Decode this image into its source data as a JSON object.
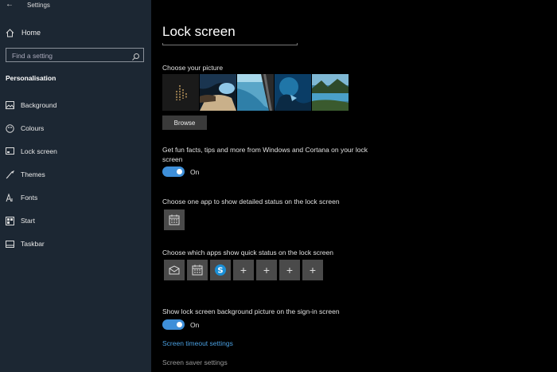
{
  "app": {
    "title": "Settings"
  },
  "sidebar": {
    "home_label": "Home",
    "search_placeholder": "Find a setting",
    "section": "Personalisation",
    "items": [
      {
        "label": "Background",
        "icon": "picture-icon"
      },
      {
        "label": "Colours",
        "icon": "palette-icon"
      },
      {
        "label": "Lock screen",
        "icon": "lock-screen-icon"
      },
      {
        "label": "Themes",
        "icon": "brush-icon"
      },
      {
        "label": "Fonts",
        "icon": "font-icon"
      },
      {
        "label": "Start",
        "icon": "start-icon"
      },
      {
        "label": "Taskbar",
        "icon": "taskbar-icon"
      }
    ]
  },
  "main": {
    "title": "Lock screen",
    "choose_picture_label": "Choose your picture",
    "browse_label": "Browse",
    "fun_facts_label": "Get fun facts, tips and more from Windows and Cortana on your lock screen",
    "fun_facts_state": "On",
    "detailed_status_label": "Choose one app to show detailed status on the lock screen",
    "quick_status_label": "Choose which apps show quick status on the lock screen",
    "signin_bg_label": "Show lock screen background picture on the sign-in screen",
    "signin_bg_state": "On",
    "timeout_link": "Screen timeout settings",
    "screensaver_link": "Screen saver settings"
  },
  "colors": {
    "accent": "#3e8fd9",
    "sidebar": "#1c2733",
    "link": "#4a9fe0"
  }
}
